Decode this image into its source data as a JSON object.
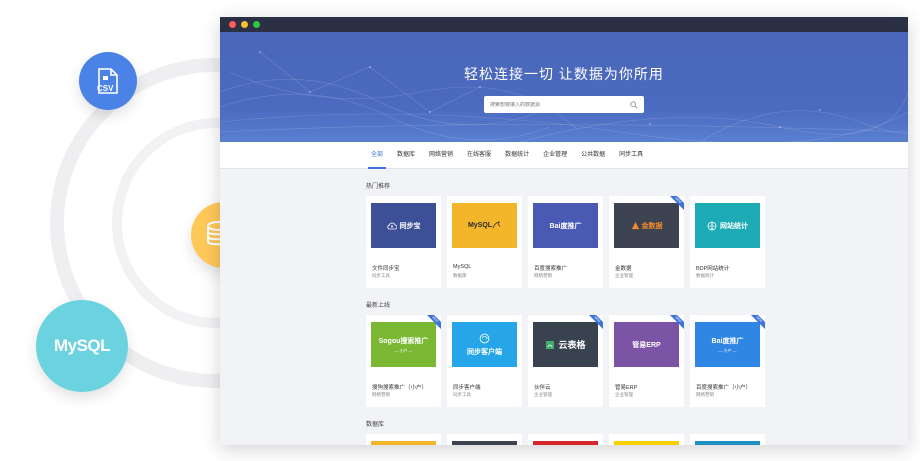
{
  "floating": {
    "csv_label": "CSV",
    "mysql_label": "MySQL"
  },
  "colors": {
    "csv_bubble": "#4b82e5",
    "db_bubble": "#ffc95a",
    "mysql_bubble": "#6bd3df",
    "hero": "#4a66b9",
    "accent": "#3b73d8"
  },
  "hero": {
    "title": "轻松连接一切 让数据为你所用",
    "search_placeholder": "搜索想要接入的数据源"
  },
  "tabs": [
    {
      "label": "全部",
      "active": true
    },
    {
      "label": "数据库"
    },
    {
      "label": "网络营销"
    },
    {
      "label": "在线客服"
    },
    {
      "label": "数据统计"
    },
    {
      "label": "企业管理"
    },
    {
      "label": "公共数据"
    },
    {
      "label": "同步工具"
    }
  ],
  "sections": [
    {
      "title": "热门推荐",
      "cards": [
        {
          "thumb_text": "同步宝",
          "thumb_color": "#3c4f97",
          "title": "文件同步宝",
          "sub": "同步工具",
          "new": false
        },
        {
          "thumb_text": "MySQL",
          "thumb_color": "#f3b62a",
          "title": "MySQL",
          "sub": "数据库",
          "new": false
        },
        {
          "thumb_text": "Bai度推广",
          "thumb_color": "#4a59b4",
          "title": "百度搜索推广",
          "sub": "网络营销",
          "new": false
        },
        {
          "thumb_text": "金数据",
          "thumb_color": "#3d4350",
          "title": "金数据",
          "sub": "企业管理",
          "new": true
        },
        {
          "thumb_text": "网站统计",
          "thumb_color": "#1caab4",
          "title": "BDP网站统计",
          "sub": "数据统计",
          "new": false
        }
      ]
    },
    {
      "title": "最新上线",
      "cards": [
        {
          "thumb_text": "Sogou搜索推广",
          "thumb_sub": "— 小户 —",
          "thumb_color": "#7ab834",
          "title": "搜狗搜索推广（小户）",
          "sub": "网络营销",
          "new": true
        },
        {
          "thumb_text": "同步客户端",
          "thumb_color": "#26a6e8",
          "title": "同步客户端",
          "sub": "同步工具",
          "new": false
        },
        {
          "thumb_text": "云表格",
          "thumb_color": "#394350",
          "title": "伙伴云",
          "sub": "企业管理",
          "new": true
        },
        {
          "thumb_text": "管易ERP",
          "thumb_color": "#7b54a6",
          "title": "管易ERP",
          "sub": "企业管理",
          "new": true
        },
        {
          "thumb_text": "Bai度推广",
          "thumb_sub": "— 小户 —",
          "thumb_color": "#2f86e4",
          "title": "百度搜索推广（小户）",
          "sub": "网络营销",
          "new": true
        }
      ]
    },
    {
      "title": "数据库",
      "partial_colors": [
        "#f3b62a",
        "#3d4350",
        "#d5262b",
        "#f8d000",
        "#1d8fc0"
      ]
    }
  ]
}
